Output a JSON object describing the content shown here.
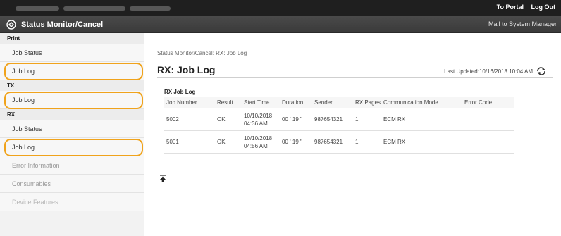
{
  "topbar": {
    "portal_label": "To Portal",
    "logout_label": "Log Out"
  },
  "header": {
    "app_title": "Status Monitor/Cancel",
    "mail_label": "Mail to System Manager"
  },
  "sidebar": {
    "print_header": "Print",
    "print_items": [
      "Job Status",
      "Job Log"
    ],
    "tx_header": "TX",
    "tx_items": [
      "Job Log"
    ],
    "rx_header": "RX",
    "rx_items": [
      "Job Status",
      "Job Log"
    ],
    "other_items": [
      "Error Information",
      "Consumables",
      "Device Features"
    ]
  },
  "main": {
    "breadcrumb": "Status Monitor/Cancel: RX: Job Log",
    "title": "RX: Job Log",
    "last_updated": "Last Updated:10/16/2018 10:04 AM",
    "table_caption": "RX Job Log",
    "columns": [
      "Job Number",
      "Result",
      "Start Time",
      "Duration",
      "Sender",
      "RX Pages",
      "Communication Mode",
      "Error Code"
    ],
    "rows": [
      {
        "job": "5002",
        "result": "OK",
        "start": "10/10/2018 04:36 AM",
        "duration": "00 ' 19 \"",
        "sender": "987654321",
        "pages": "1",
        "mode": "ECM RX",
        "error": ""
      },
      {
        "job": "5001",
        "result": "OK",
        "start": "10/10/2018 04:56 AM",
        "duration": "00 ' 19 \"",
        "sender": "987654321",
        "pages": "1",
        "mode": "ECM RX",
        "error": ""
      }
    ]
  },
  "colors": {
    "highlight": "#f0a31c",
    "topbar": "#1f1f1f",
    "header": "#3f3f3f"
  },
  "icons": [
    "status-monitor-icon",
    "refresh-icon",
    "back-to-top-icon"
  ]
}
